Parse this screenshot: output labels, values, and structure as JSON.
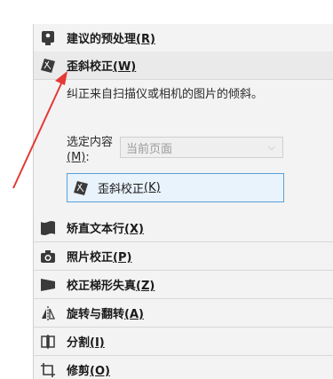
{
  "panel": {
    "items": [
      {
        "name": "recommended-preprocessing",
        "label": "建议的预处理",
        "key": "(R)"
      },
      {
        "name": "deskew",
        "label": "歪斜校正",
        "key": "(W)"
      },
      {
        "name": "straighten-text-lines",
        "label": "矫直文本行",
        "key": "(X)"
      },
      {
        "name": "photo-correction",
        "label": "照片校正",
        "key": "(P)"
      },
      {
        "name": "correct-trapezoid",
        "label": "校正梯形失真",
        "key": "(Z)"
      },
      {
        "name": "rotate-flip",
        "label": "旋转与翻转",
        "key": "(A)"
      },
      {
        "name": "split",
        "label": "分割",
        "key": "(I)"
      },
      {
        "name": "crop",
        "label": "修剪",
        "key": "(O)"
      }
    ],
    "deskew": {
      "description": "纠正来自扫描仪或相机的图片的倾斜。",
      "scope_label": "选定内容",
      "scope_key": "(M)",
      "scope_colon": ":",
      "scope_value": "当前页面",
      "button_label": "歪斜校正",
      "button_key": "(K)"
    }
  },
  "colors": {
    "accent_border": "#5aa0d6",
    "arrow": "#e53935"
  }
}
